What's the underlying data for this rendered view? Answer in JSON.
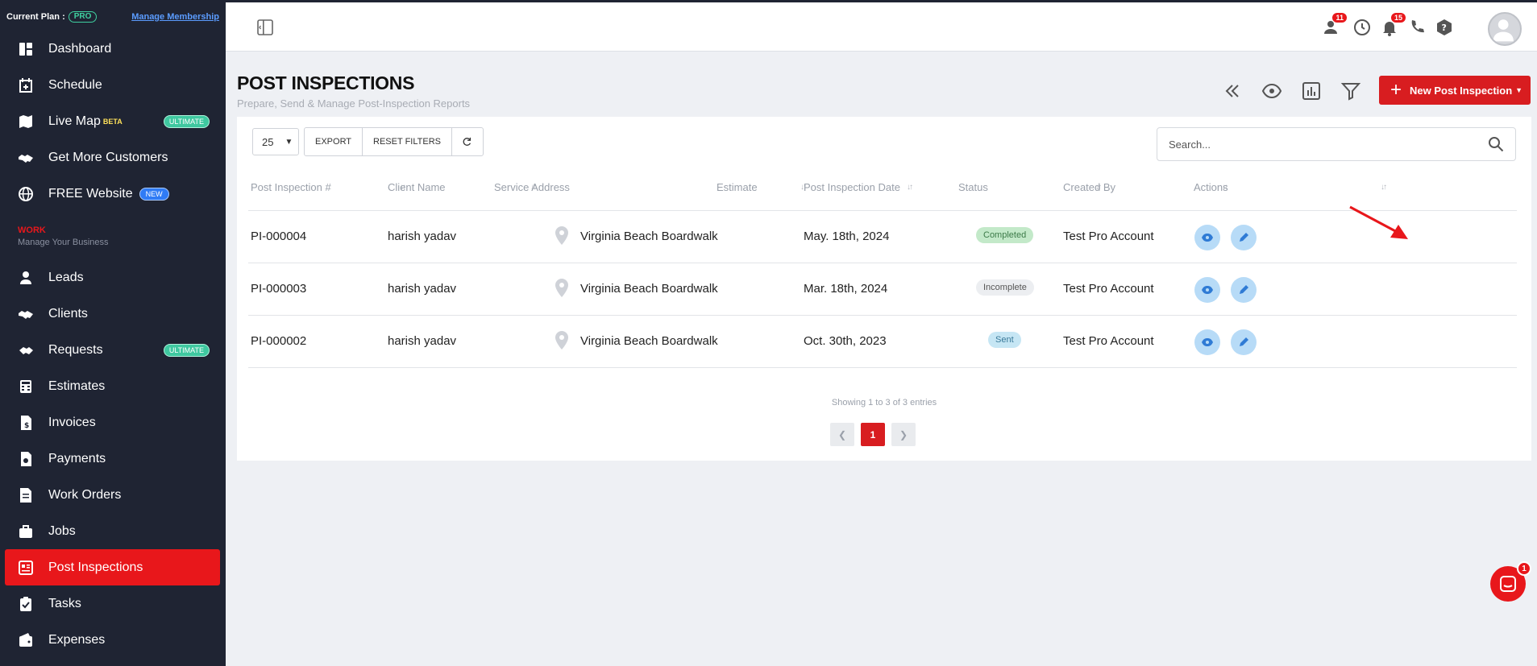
{
  "plan": {
    "label": "Current Plan :",
    "badge": "PRO",
    "manage_link": "Manage Membership"
  },
  "sidebar": {
    "items": [
      {
        "label": "Dashboard",
        "icon": "dashboard-icon"
      },
      {
        "label": "Schedule",
        "icon": "calendar-icon"
      },
      {
        "label": "Live Map",
        "icon": "map-icon",
        "sup": "BETA",
        "badge": "ULTIMATE"
      },
      {
        "label": "Get More Customers",
        "icon": "handshake-icon"
      },
      {
        "label": "FREE Website",
        "icon": "globe-icon",
        "badge": "NEW"
      },
      {
        "label": "Leads",
        "icon": "leads-icon"
      },
      {
        "label": "Clients",
        "icon": "clients-icon"
      },
      {
        "label": "Requests",
        "icon": "requests-icon",
        "badge": "ULTIMATE"
      },
      {
        "label": "Estimates",
        "icon": "calculator-icon"
      },
      {
        "label": "Invoices",
        "icon": "invoice-icon"
      },
      {
        "label": "Payments",
        "icon": "payment-icon"
      },
      {
        "label": "Work Orders",
        "icon": "work-order-icon"
      },
      {
        "label": "Jobs",
        "icon": "briefcase-icon"
      },
      {
        "label": "Post Inspections",
        "icon": "inspection-icon",
        "active": true
      },
      {
        "label": "Tasks",
        "icon": "tasks-icon"
      },
      {
        "label": "Expenses",
        "icon": "wallet-icon"
      }
    ],
    "section": {
      "title": "WORK",
      "subtitle": "Manage Your Business"
    }
  },
  "topbar": {
    "badges": {
      "team": "11",
      "notifications": "15"
    },
    "icons": [
      "sidebar-toggle-icon",
      "team-icon",
      "clock-icon",
      "bell-icon",
      "phone-icon",
      "help-icon",
      "avatar"
    ]
  },
  "page": {
    "title": "POST INSPECTIONS",
    "subtitle": "Prepare, Send & Manage Post-Inspection Reports",
    "new_button": "New Post Inspection"
  },
  "toolbar": {
    "per_page": "25",
    "export": "EXPORT",
    "reset_filters": "RESET FILTERS",
    "search_placeholder": "Search..."
  },
  "table": {
    "columns": [
      "Post Inspection #",
      "Client Name",
      "Service Address",
      "Estimate",
      "Post Inspection Date",
      "Status",
      "Created By",
      "Actions"
    ],
    "rows": [
      {
        "id": "PI-000004",
        "client": "harish yadav",
        "address": "Virginia Beach Boardwalk",
        "estimate": "",
        "date": "May. 18th, 2024",
        "status": "Completed",
        "created_by": "Test Pro Account"
      },
      {
        "id": "PI-000003",
        "client": "harish yadav",
        "address": "Virginia Beach Boardwalk",
        "estimate": "",
        "date": "Mar. 18th, 2024",
        "status": "Incomplete",
        "created_by": "Test Pro Account"
      },
      {
        "id": "PI-000002",
        "client": "harish yadav",
        "address": "Virginia Beach Boardwalk",
        "estimate": "",
        "date": "Oct. 30th, 2023",
        "status": "Sent",
        "created_by": "Test Pro Account"
      }
    ],
    "showing": "Showing 1 to 3 of 3 entries",
    "current_page": "1"
  },
  "chat": {
    "badge": "1"
  },
  "colors": {
    "brand_red": "#d81d20",
    "sidebar_bg": "#1f2433",
    "accent_green": "#3fc8a0"
  }
}
